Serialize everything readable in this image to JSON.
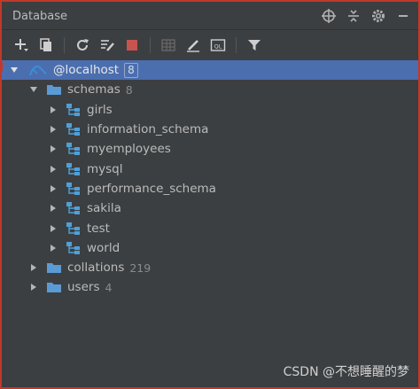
{
  "panel": {
    "title": "Database"
  },
  "toolbar": {
    "buttons": [
      "add-icon",
      "copy-icon",
      "refresh-icon",
      "edit-schema-icon",
      "stop-icon",
      "table-icon",
      "edit-icon",
      "sql-console-icon",
      "filter-icon"
    ]
  },
  "tree": {
    "host": {
      "label": "@localhost",
      "count": "8"
    },
    "schemas": {
      "label": "schemas",
      "count": "8"
    },
    "schema_items": [
      "girls",
      "information_schema",
      "myemployees",
      "mysql",
      "performance_schema",
      "sakila",
      "test",
      "world"
    ],
    "collations": {
      "label": "collations",
      "count": "219"
    },
    "users": {
      "label": "users",
      "count": "4"
    }
  },
  "colors": {
    "background": "#3c3f41",
    "selection": "#4b6eaf",
    "folder": "#5a9bd5",
    "schema": "#4fa0d8",
    "stop": "#c75450"
  },
  "watermark": "CSDN @不想睡醒的梦"
}
